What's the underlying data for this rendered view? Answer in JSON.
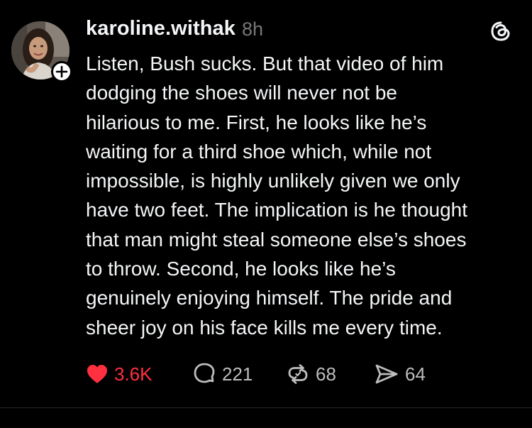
{
  "post": {
    "username": "karoline.withak",
    "timestamp": "8h",
    "body": "Listen, Bush sucks. But that video of him\ndodging the shoes will never not be\nhilarious to me. First, he looks like he’s\nwaiting for a third shoe which, while not\nimpossible, is highly unlikely given we only\nhave two feet. The implication is he thought\nthat man might steal someone else’s shoes\nto throw. Second, he looks like he’s\ngenuinely enjoying himself. The pride and\nsheer joy on his face kills me every time."
  },
  "actions": {
    "likes": "3.6K",
    "replies": "221",
    "reposts": "68",
    "shares": "64"
  },
  "icons": {
    "avatar": "profile-photo",
    "follow": "plus-icon",
    "app_logo": "threads-logo-icon",
    "like": "heart-icon",
    "reply": "comment-bubble-icon",
    "repost": "repost-icon",
    "share": "send-icon"
  },
  "colors": {
    "background": "#000000",
    "text": "#f3f5f7",
    "muted": "#777777",
    "like": "#ff3040",
    "counts": "#bdbdbd"
  }
}
